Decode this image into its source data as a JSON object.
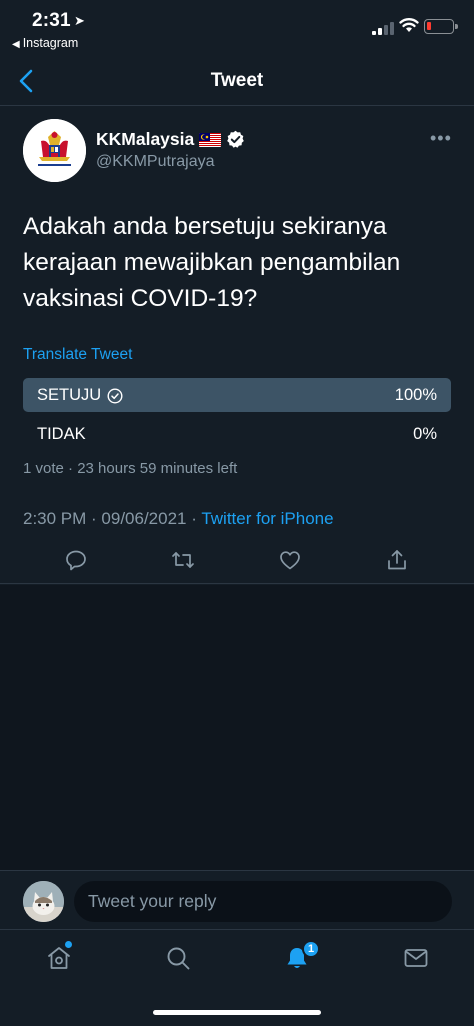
{
  "status_bar": {
    "time": "2:31",
    "back_app": "Instagram"
  },
  "nav": {
    "title": "Tweet"
  },
  "tweet": {
    "display_name": "KKMalaysia",
    "handle": "@KKMPutrajaya",
    "text": "Adakah anda bersetuju sekiranya kerajaan mewajibkan pengambilan vaksinasi COVID-19?",
    "translate_label": "Translate Tweet",
    "poll": {
      "options": [
        {
          "label": "SETUJU",
          "percent": "100%",
          "fill": 1.0,
          "selected": true
        },
        {
          "label": "TIDAK",
          "percent": "0%",
          "fill": 0.0,
          "selected": false
        }
      ],
      "meta": "1 vote · 23 hours 59 minutes left"
    },
    "timestamp": "2:30 PM · 09/06/2021 · ",
    "source": "Twitter for iPhone"
  },
  "reply": {
    "placeholder": "Tweet your reply"
  },
  "tabbar": {
    "notifications_badge": "1"
  },
  "colors": {
    "background": "#141d26",
    "accent": "#1da1f2",
    "muted": "#8899a6",
    "poll_fill": "#3d5466"
  }
}
